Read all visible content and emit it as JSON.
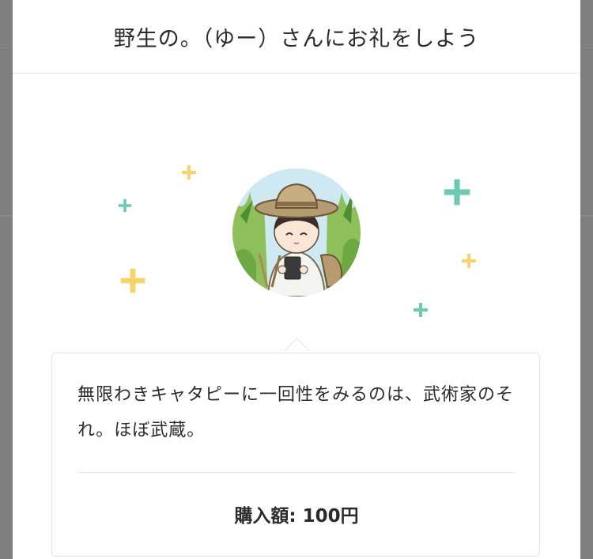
{
  "modal": {
    "title": "野生の。（ゆー）さんにお礼をしよう"
  },
  "creator": {
    "avatar_icon": "creator-avatar-illustration"
  },
  "sparkles": {
    "colors": {
      "yellow": "#f6d46a",
      "teal": "#6cc9b2"
    }
  },
  "message_card": {
    "message": "無限わきキャタピーに一回性をみるのは、武術家のそれ。ほぼ武蔵。",
    "price_label": "購入額:",
    "price_value": "100円"
  }
}
